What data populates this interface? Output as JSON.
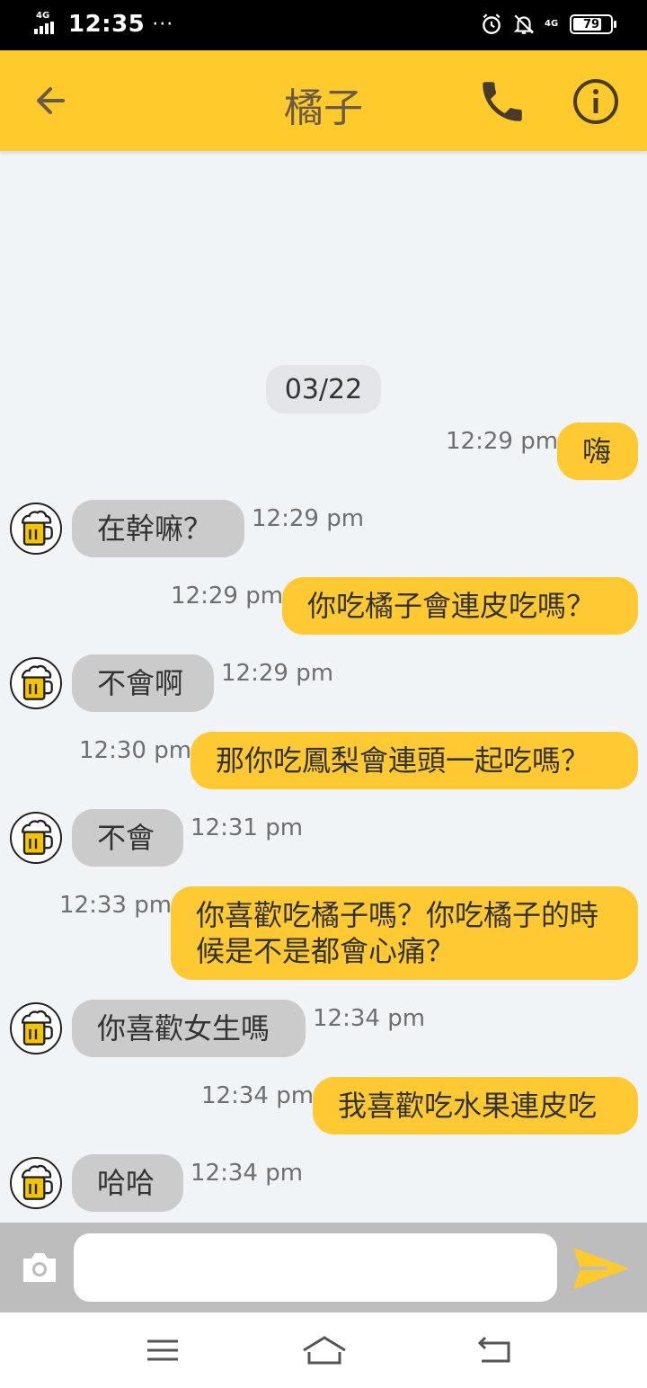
{
  "status_bar": {
    "network": "4G",
    "time": "12:35",
    "more": "···",
    "data_network": "4G",
    "battery_level": "79"
  },
  "header": {
    "title": "橘子",
    "icons": {
      "back": "arrow-left-icon",
      "call": "phone-icon",
      "info": "info-icon"
    }
  },
  "chat": {
    "date": "03/22",
    "messages": [
      {
        "sender": "me",
        "text": "嗨",
        "time": "12:29 pm"
      },
      {
        "sender": "other",
        "text": "在幹嘛？",
        "time": "12:29 pm"
      },
      {
        "sender": "me",
        "text": "你吃橘子會連皮吃嗎？",
        "time": "12:29 pm"
      },
      {
        "sender": "other",
        "text": "不會啊",
        "time": "12:29 pm"
      },
      {
        "sender": "me",
        "text": "那你吃鳳梨會連頭一起吃嗎？",
        "time": "12:30 pm"
      },
      {
        "sender": "other",
        "text": "不會",
        "time": "12:31 pm"
      },
      {
        "sender": "me",
        "text": "你喜歡吃橘子嗎？你吃橘子的時候是不是都會心痛？",
        "time": "12:33 pm"
      },
      {
        "sender": "other",
        "text": "你喜歡女生嗎",
        "time": "12:34 pm"
      },
      {
        "sender": "me",
        "text": "我喜歡吃水果連皮吃",
        "time": "12:34 pm"
      },
      {
        "sender": "other",
        "text": "哈哈",
        "time": "12:34 pm"
      }
    ]
  },
  "composer": {
    "placeholder": "",
    "value": "",
    "icons": {
      "camera": "camera-icon",
      "send": "send-icon"
    }
  },
  "colors": {
    "accent": "#ffca2c",
    "my_bubble": "#ffc933",
    "other_bubble": "#cbcbcb",
    "background": "#f1f4f7"
  }
}
